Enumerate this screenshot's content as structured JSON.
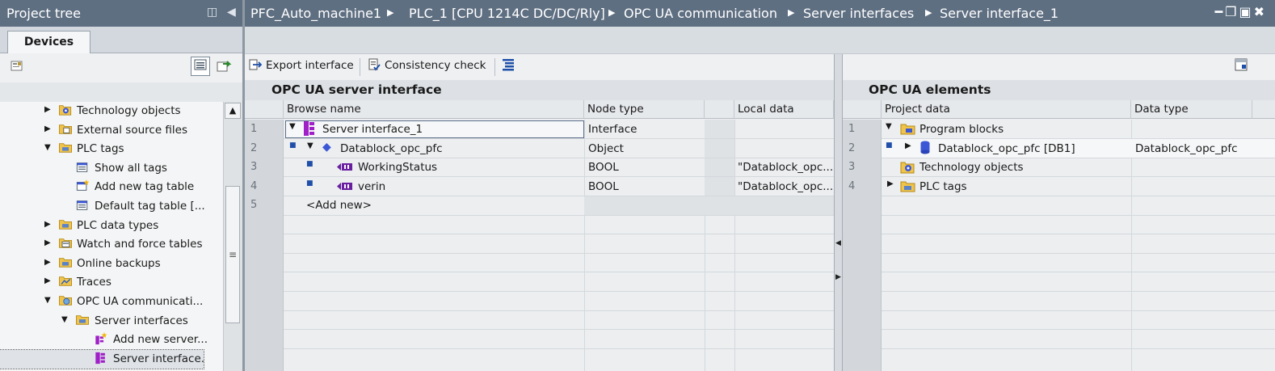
{
  "project_tree": {
    "title": "Project tree",
    "tab": "Devices",
    "items": [
      {
        "label": "Technology objects",
        "icon": "technology-objects-icon",
        "level": 1,
        "toggle": "collapsed"
      },
      {
        "label": "External source files",
        "icon": "external-source-files-icon",
        "level": 1,
        "toggle": "collapsed"
      },
      {
        "label": "PLC tags",
        "icon": "folder-icon",
        "level": 1,
        "toggle": "expanded"
      },
      {
        "label": "Show all tags",
        "icon": "tag-table-icon",
        "level": 2,
        "toggle": "none"
      },
      {
        "label": "Add new tag table",
        "icon": "add-tag-table-icon",
        "level": 2,
        "toggle": "none"
      },
      {
        "label": "Default tag table [...",
        "icon": "tag-table-icon",
        "level": 2,
        "toggle": "none"
      },
      {
        "label": "PLC data types",
        "icon": "folder-icon",
        "level": 1,
        "toggle": "collapsed"
      },
      {
        "label": "Watch and force tables",
        "icon": "watch-table-icon",
        "level": 1,
        "toggle": "collapsed"
      },
      {
        "label": "Online backups",
        "icon": "folder-icon",
        "level": 1,
        "toggle": "collapsed"
      },
      {
        "label": "Traces",
        "icon": "traces-icon",
        "level": 1,
        "toggle": "collapsed"
      },
      {
        "label": "OPC UA communicati...",
        "icon": "opc-ua-icon",
        "level": 1,
        "toggle": "expanded"
      },
      {
        "label": "Server interfaces",
        "icon": "folder-icon",
        "level": 2,
        "toggle": "expanded"
      },
      {
        "label": "Add new server...",
        "icon": "add-server-icon",
        "level": 3,
        "toggle": "none"
      },
      {
        "label": "Server interface.",
        "icon": "server-interface-icon",
        "level": 3,
        "toggle": "none",
        "selected": true
      }
    ]
  },
  "breadcrumb": [
    "PFC_Auto_machine1",
    "PLC_1 [CPU 1214C DC/DC/Rly]",
    "OPC UA communication",
    "Server interfaces",
    "Server interface_1"
  ],
  "toolbar": {
    "export_label": "Export interface",
    "consistency_label": "Consistency check"
  },
  "server_interface": {
    "title": "OPC UA server interface",
    "columns": [
      "Browse name",
      "Node type",
      "Local data"
    ],
    "rows": [
      {
        "num": "1",
        "name": "Server interface_1",
        "node_type": "Interface",
        "local_data": ""
      },
      {
        "num": "2",
        "name": "Datablock_opc_pfc",
        "node_type": "Object",
        "local_data": ""
      },
      {
        "num": "3",
        "name": "WorkingStatus",
        "node_type": "BOOL",
        "local_data": "\"Datablock_opc..."
      },
      {
        "num": "4",
        "name": "verin",
        "node_type": "BOOL",
        "local_data": "\"Datablock_opc..."
      },
      {
        "num": "5",
        "name": "<Add new>",
        "node_type": "",
        "local_data": ""
      }
    ]
  },
  "elements": {
    "title": "OPC UA elements",
    "columns": [
      "Project data",
      "Data type"
    ],
    "rows": [
      {
        "num": "1",
        "name": "Program blocks",
        "data_type": ""
      },
      {
        "num": "2",
        "name": "Datablock_opc_pfc [DB1]",
        "data_type": "Datablock_opc_pfc"
      },
      {
        "num": "3",
        "name": "Technology objects",
        "data_type": ""
      },
      {
        "num": "4",
        "name": "PLC tags",
        "data_type": ""
      }
    ]
  },
  "colors": {
    "title_bar": "#5f6f82",
    "interface_icon": "#a020c8",
    "db_icon": "#3b57d6"
  }
}
